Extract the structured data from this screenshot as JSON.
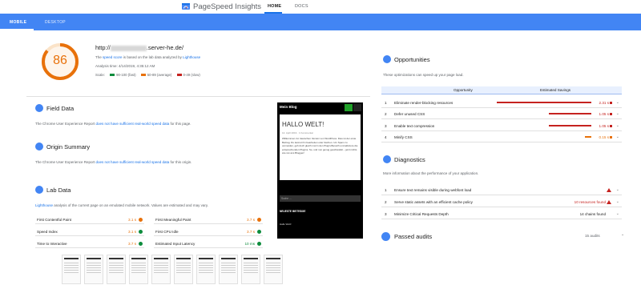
{
  "app": {
    "brand": "PageSpeed Insights",
    "nav": [
      "HOME",
      "DOCS"
    ]
  },
  "device_tabs": [
    "MOBILE",
    "DESKTOP"
  ],
  "summary": {
    "score": "86",
    "url_suffix": ".server-he.de/",
    "url_prefix": "http://",
    "info_pre": "The",
    "info_link": "speed score",
    "info_mid": "is based on the lab data analyzed by",
    "info_link2": "Lighthouse",
    "analysis_time": "Analysis time: 4/14/2019, 4:35:12 AM",
    "scale_label": "Scale:",
    "scale": [
      "90-100 (fast)",
      "50-89 (average)",
      "0-49 (slow)"
    ],
    "colors": {
      "fast": "#0d8c3c",
      "average": "#e8710a",
      "slow": "#c5221f",
      "accent": "#4285f4"
    }
  },
  "field_data": {
    "title": "Field Data",
    "text_pre": "The Chrome User Experience Report",
    "text_link": "does not have sufficient real-world speed data",
    "text_post": "for this page."
  },
  "origin_summary": {
    "title": "Origin Summary",
    "text_pre": "The Chrome User Experience Report",
    "text_link": "does not have sufficient real-world speed data",
    "text_post": "for this origin."
  },
  "lab_data": {
    "title": "Lab Data",
    "desc_link": "Lighthouse",
    "desc": "analysis of the current page on an emulated mobile network. Values are estimated and may vary.",
    "metrics": [
      {
        "name": "First Contentful Paint",
        "value": "3.1 s",
        "status": "average"
      },
      {
        "name": "Speed Index",
        "value": "3.1 s",
        "status": "fast"
      },
      {
        "name": "Time to Interactive",
        "value": "3.7 s",
        "status": "fast"
      },
      {
        "name": "First Meaningful Paint",
        "value": "3.7 s",
        "status": "average"
      },
      {
        "name": "First CPU Idle",
        "value": "3.7 s",
        "status": "fast"
      },
      {
        "name": "Estimated Input Latency",
        "value": "10 ms",
        "status": "fast"
      }
    ]
  },
  "preview": {
    "brand": "Mein Blog",
    "heading": "HALLO WELT!",
    "meta": "14. April 2019 · 1 Kommentar",
    "paragraph": "Willkommen zur deutschen Version von WordPress. Dies ist der erste Beitrag. Du kannst ihn bearbeiten oder löschen. Um Spam zu vermeiden, geh doch gleich mal in den Plugin-Bereich und aktiviere die entsprechenden Plugins. So, und nun genug geschwafelt – jetzt nichts wie ran ans Bloggen!",
    "search": "Suche ...",
    "recent": "NEUESTE BEITRÄGE",
    "post": "Hallo Welt!"
  },
  "opportunities": {
    "title": "Opportunities",
    "desc": "These optimizations can speed up your page load.",
    "col_opportunity": "Opportunity",
    "col_savings": "Estimated Savings",
    "items": [
      {
        "num": "1",
        "name": "Eliminate render-blocking resources",
        "savings": "2.31 s",
        "level": "slow",
        "fraction": 1.0
      },
      {
        "num": "2",
        "name": "Defer unused CSS",
        "savings": "1.05 s",
        "level": "slow",
        "fraction": 0.45
      },
      {
        "num": "3",
        "name": "Enable text compression",
        "savings": "1.05 s",
        "level": "slow",
        "fraction": 0.45
      },
      {
        "num": "4",
        "name": "Minify CSS",
        "savings": "0.15 s",
        "level": "average",
        "fraction": 0.07
      }
    ]
  },
  "diagnostics": {
    "title": "Diagnostics",
    "desc": "More information about the performance of your application.",
    "items": [
      {
        "num": "1",
        "name": "Ensure text remains visible during webfont load",
        "value": "",
        "warn": true
      },
      {
        "num": "2",
        "name": "Serve static assets with an efficient cache policy",
        "value": "10 resources found",
        "warn": true
      },
      {
        "num": "3",
        "name": "Minimize Critical Requests Depth",
        "value": "14 chains found",
        "warn": false
      }
    ]
  },
  "passed": {
    "title": "Passed audits",
    "count": "15 audits"
  }
}
